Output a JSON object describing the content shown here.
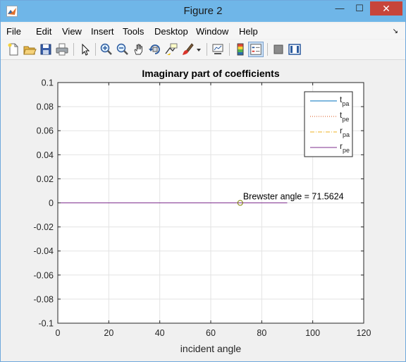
{
  "window": {
    "title": "Figure 2",
    "minimize_glyph": "—",
    "maximize_glyph": "☐",
    "close_glyph": "✕"
  },
  "menu": {
    "items": [
      "File",
      "Edit",
      "View",
      "Insert",
      "Tools",
      "Desktop",
      "Window",
      "Help"
    ],
    "dock_glyph": "↘"
  },
  "toolbar": {
    "icons": [
      "new-figure-icon",
      "open-file-icon",
      "save-icon",
      "print-icon",
      "pointer-icon",
      "zoom-in-icon",
      "zoom-out-icon",
      "pan-hand-icon",
      "rotate-3d-icon",
      "data-cursor-icon",
      "brush-icon",
      "brush-dropdown-icon",
      "link-plot-icon",
      "colorbar-icon",
      "legend-icon",
      "hide-plot-tools-icon",
      "show-plot-tools-icon"
    ],
    "colors": {
      "active_bg": "#c9dff5",
      "active_border": "#7da2ce"
    }
  },
  "chart_data": {
    "type": "line",
    "title": "Imaginary part of coefficients",
    "xlabel": "incident angle",
    "ylabel": "",
    "xlim": [
      0,
      120
    ],
    "ylim": [
      -0.1,
      0.1
    ],
    "xticks": [
      0,
      20,
      40,
      60,
      80,
      100,
      120
    ],
    "yticks": [
      0.1,
      0.08,
      0.06,
      0.04,
      0.02,
      0,
      -0.02,
      -0.04,
      -0.06,
      -0.08,
      -0.1
    ],
    "xtick_labels": [
      "0",
      "20",
      "40",
      "60",
      "80",
      "100",
      "120"
    ],
    "ytick_labels": [
      "0.1",
      "0.08",
      "0.06",
      "0.04",
      "0.02",
      "0",
      "-0.02",
      "-0.04",
      "-0.06",
      "-0.08",
      "-0.1"
    ],
    "grid": true,
    "legend_position": "top-right",
    "series": [
      {
        "name": "t",
        "sub": "pa",
        "style": "solid",
        "color": "#0072bd",
        "x": [
          0,
          90
        ],
        "y": [
          0,
          0
        ]
      },
      {
        "name": "t",
        "sub": "pe",
        "style": "dotted",
        "color": "#d95319",
        "x": [
          0,
          90
        ],
        "y": [
          0,
          0
        ]
      },
      {
        "name": "r",
        "sub": "pa",
        "style": "dashdot",
        "color": "#edb120",
        "x": [
          0,
          90
        ],
        "y": [
          0,
          0
        ]
      },
      {
        "name": "r",
        "sub": "pe",
        "style": "solid",
        "color": "#7e2f8e",
        "x": [
          0,
          90
        ],
        "y": [
          0,
          0
        ]
      }
    ],
    "annotation": {
      "text": "Brewster angle = 71.5624",
      "x": 71.5624,
      "y": 0,
      "marker": "circle",
      "marker_color": "#7e7e00"
    }
  }
}
